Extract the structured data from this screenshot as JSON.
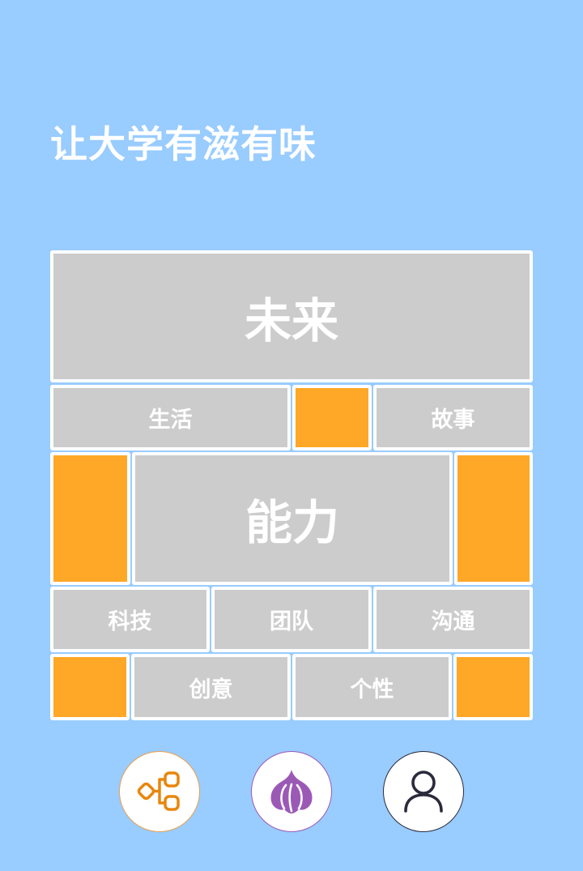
{
  "header": {
    "title": "让大学有滋有味"
  },
  "grid": {
    "future": "未来",
    "life": "生活",
    "story": "故事",
    "ability": "能力",
    "tech": "科技",
    "team": "团队",
    "communication": "沟通",
    "creativity": "创意",
    "personality": "个性"
  },
  "colors": {
    "background": "#99CCFF",
    "tile": "#CCCCCC",
    "accent": "#FFA726",
    "tile_border": "#FFFFFF"
  },
  "bottom_nav": {
    "items": [
      {
        "icon": "network-icon",
        "color": "#E8860C"
      },
      {
        "icon": "onion-icon",
        "color": "#9B59B6"
      },
      {
        "icon": "user-icon",
        "color": "#2A2A3C"
      }
    ]
  }
}
